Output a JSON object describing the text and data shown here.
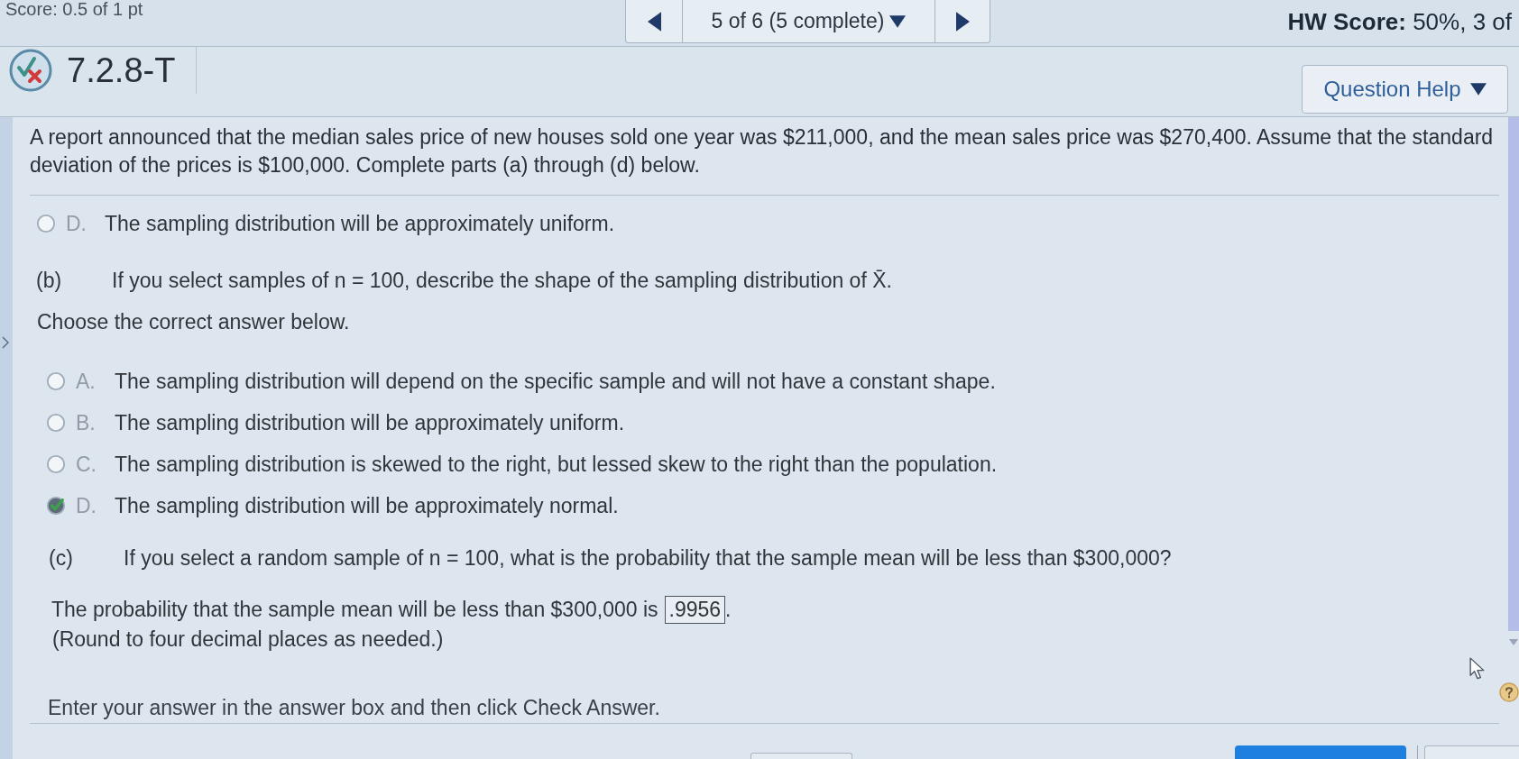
{
  "top_bar": {
    "score": "Score: 0.5 of 1 pt",
    "pager": "5 of 6 (5 complete)",
    "hw_score": "**HW Score:** 50%, 3 of"
  },
  "question_header": {
    "check_mark": true,
    "cross_mark": true,
    "number": "7.2.8-T",
    "help_button": "Question Help"
  },
  "prompt": "A report announced that the median sales price of new houses sold one year was $211,000, and the mean sales price was $270,400. Assume that the standard deviation of the prices is $100,000. Complete parts (a) through (d) below.",
  "part_a": {
    "options": [
      {
        "letter": "D.",
        "text": "The sampling distribution will be approximately uniform.",
        "selected": false
      }
    ]
  },
  "part_b": {
    "label": "(b)",
    "question": "If you select samples of n = 100, describe the shape of the sampling distribution of X̄.",
    "instruction": "Choose the correct answer below.",
    "options": [
      {
        "letter": "A.",
        "text": "The sampling distribution will depend on the specific sample and will not have a constant shape.",
        "selected": false
      },
      {
        "letter": "B.",
        "text": "The sampling distribution will be approximately uniform.",
        "selected": false
      },
      {
        "letter": "C.",
        "text": "The sampling distribution is skewed to the right, but lessed skew to the right than the population.",
        "selected": false
      },
      {
        "letter": "D.",
        "text": "The sampling distribution will be approximately normal.",
        "selected": true
      }
    ]
  },
  "part_c": {
    "label": "(c)",
    "question": "If you select a random sample of n = 100, what is the probability that the sample mean will be less than $300,000?",
    "answer_text": "The probability that the sample mean will be less than $300,000 is",
    "answer": ".9956",
    "answer_end": ".",
    "note": "(Round to four decimal places as needed.)"
  },
  "instructions": "Enter your answer in the answer box and then click Check Answer."
}
